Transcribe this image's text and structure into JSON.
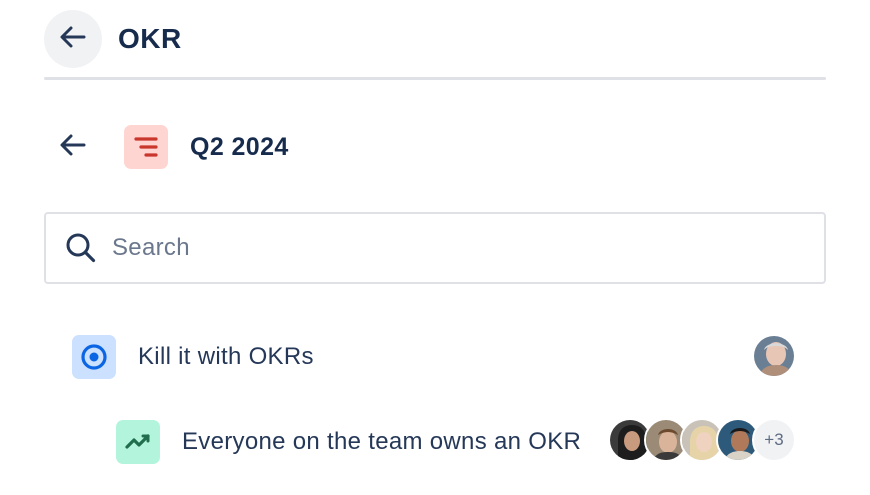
{
  "header": {
    "title": "OKR"
  },
  "period": {
    "title": "Q2 2024"
  },
  "search": {
    "placeholder": "Search"
  },
  "items": [
    {
      "label": "Kill it with OKRs",
      "type": "goal"
    },
    {
      "label": "Everyone on the team owns an OKR",
      "type": "key-result",
      "more_count": "+3"
    }
  ],
  "colors": {
    "period_icon_bg": "#ffd5d2",
    "period_icon_fg": "#c9372c",
    "goal_icon_bg": "#cce0ff",
    "goal_icon_fg": "#0c66e4",
    "kr_icon_bg": "#b3f5dc",
    "kr_icon_fg": "#216e4e",
    "text": "#172b4d"
  }
}
